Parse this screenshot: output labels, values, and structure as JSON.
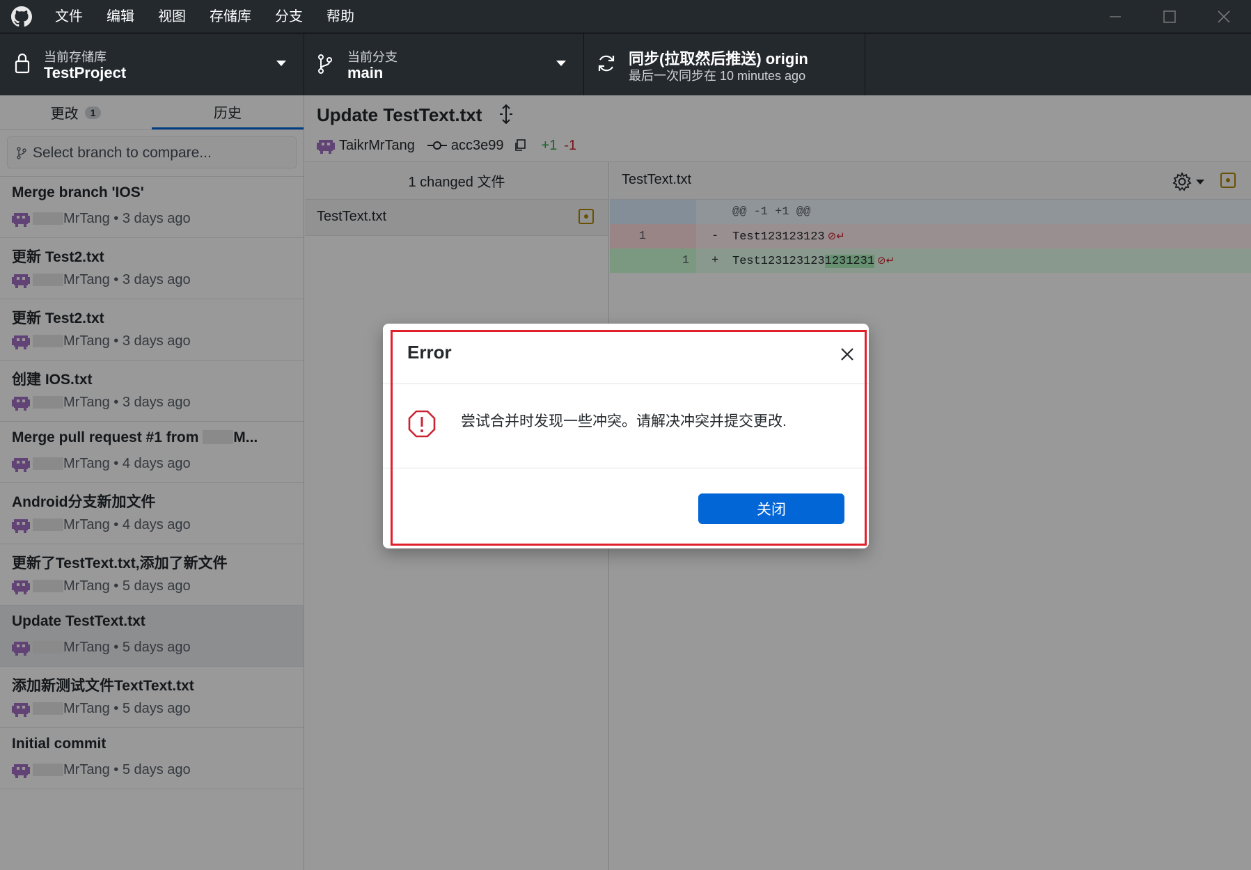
{
  "menu": [
    "文件",
    "编辑",
    "视图",
    "存储库",
    "分支",
    "帮助"
  ],
  "toolbar": {
    "repo": {
      "label": "当前存储库",
      "value": "TestProject"
    },
    "branch": {
      "label": "当前分支",
      "value": "main"
    },
    "sync": {
      "title": "同步(拉取然后推送) origin",
      "subtitle": "最后一次同步在 10 minutes ago"
    }
  },
  "sidebar": {
    "tabs": [
      {
        "label": "更改",
        "count": "1"
      },
      {
        "label": "历史"
      }
    ],
    "compare_placeholder": "Select branch to compare...",
    "commits": [
      {
        "title": "Merge branch 'IOS'",
        "author": "MrTang",
        "time": "• 3 days ago"
      },
      {
        "title": "更新 Test2.txt",
        "author": "MrTang",
        "time": "• 3 days ago"
      },
      {
        "title": "更新 Test2.txt",
        "author": "MrTang",
        "time": "• 3 days ago"
      },
      {
        "title": "创建 IOS.txt",
        "author": "MrTang",
        "time": "• 3 days ago"
      },
      {
        "title": "Merge pull request #1 from",
        "title_suffix": "M...",
        "author": "MrTang",
        "time": "• 4 days ago"
      },
      {
        "title": "Android分支新加文件",
        "author": "MrTang",
        "time": "• 4 days ago"
      },
      {
        "title": "更新了TestText.txt,添加了新文件",
        "author": "MrTang",
        "time": "• 5 days ago"
      },
      {
        "title": "Update TestText.txt",
        "author": "MrTang",
        "time": "• 5 days ago"
      },
      {
        "title": "添加新测试文件TextText.txt",
        "author": "MrTang",
        "time": "• 5 days ago"
      },
      {
        "title": "Initial commit",
        "author": "MrTang",
        "time": "• 5 days ago"
      }
    ]
  },
  "commit_detail": {
    "title": "Update TestText.txt",
    "author": "TaikrMrTang",
    "sha": "acc3e99",
    "additions": "+1",
    "deletions": "-1"
  },
  "files": {
    "header": "1 changed 文件",
    "items": [
      "TestText.txt"
    ]
  },
  "diff": {
    "filename": "TestText.txt",
    "hunk": "@@ -1 +1 @@",
    "removed": {
      "old": "1",
      "sign": "-",
      "text": "Test123123123"
    },
    "added": {
      "new": "1",
      "sign": "+",
      "text": "Test123123123",
      "highlight": "1231231"
    }
  },
  "dialog": {
    "title": "Error",
    "message": "尝试合并时发现一些冲突。请解决冲突并提交更改.",
    "button": "关闭"
  },
  "colors": {
    "accent": "#0366d6",
    "highlight_border": "#e0202a",
    "dark": "#24292e"
  }
}
